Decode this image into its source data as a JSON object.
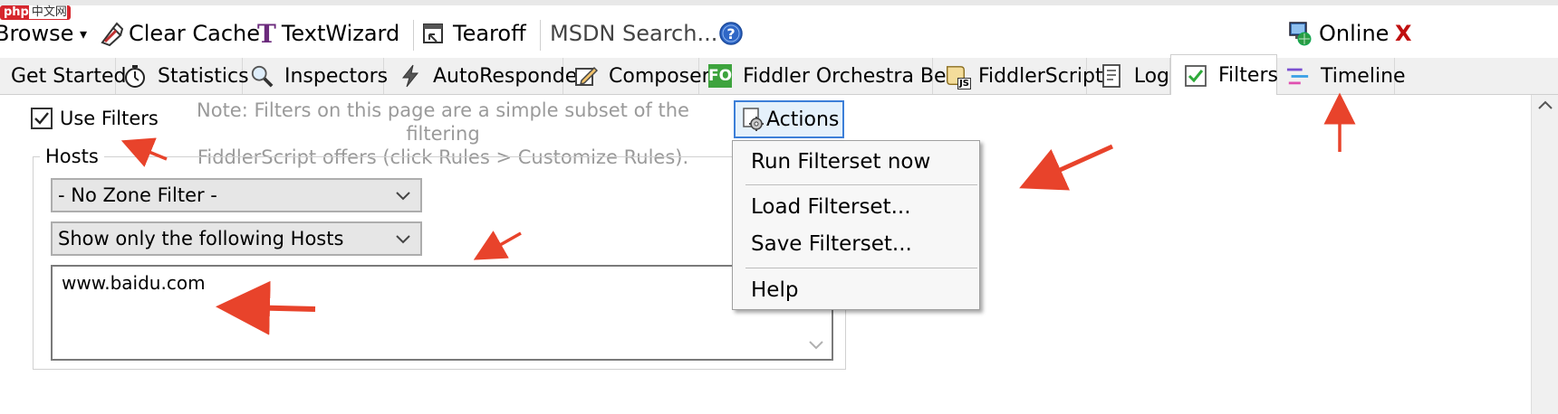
{
  "watermark": {
    "brand": "php",
    "site": "中文网"
  },
  "toolbar": {
    "browse_label": "Browse",
    "clear_cache_label": "Clear Cache",
    "textwizard_label": "TextWizard",
    "tearoff_label": "Tearoff",
    "msdn_search_placeholder": "MSDN Search...",
    "online_label": "Online",
    "close_glyph": "X"
  },
  "tabs": [
    {
      "label": "Get Started"
    },
    {
      "label": "Statistics"
    },
    {
      "label": "Inspectors"
    },
    {
      "label": "AutoResponder"
    },
    {
      "label": "Composer"
    },
    {
      "label": "Fiddler Orchestra Beta",
      "badge": "FO"
    },
    {
      "label": "FiddlerScript",
      "badge": "JS"
    },
    {
      "label": "Log"
    },
    {
      "label": "Filters",
      "active": true
    },
    {
      "label": "Timeline"
    }
  ],
  "filters": {
    "use_filters_label": "Use Filters",
    "use_filters_checked": true,
    "note_line1": "Note: Filters on this page are a simple subset of the filtering",
    "note_line2": "FiddlerScript offers (click Rules > Customize Rules).",
    "actions_label": "Actions",
    "hosts_group_label": "Hosts",
    "zone_filter_value": "- No Zone Filter -",
    "host_filter_value": "Show only the following Hosts",
    "hosts_text": "www.baidu.com"
  },
  "actions_menu": {
    "run_filterset": "Run Filterset now",
    "load_filterset": "Load Filterset...",
    "save_filterset": "Save Filterset...",
    "help": "Help"
  },
  "colors": {
    "annotation_arrow": "#e8432b",
    "accent_blue": "#3c7fd8",
    "fo_badge": "#3da33d",
    "checkmark_green": "#2eaa3a"
  }
}
